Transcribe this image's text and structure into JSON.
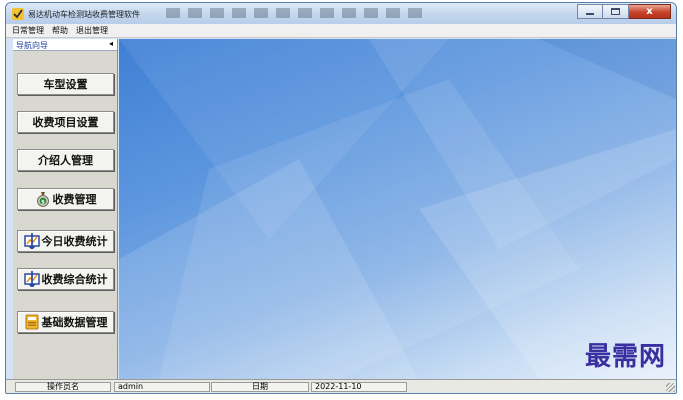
{
  "window": {
    "title": "易达机动车检测站收费管理软件",
    "title_extra": "blurred-toolbar-text",
    "icon": "app-checkmark-icon"
  },
  "window_controls": {
    "minimize_icon": "minimize-icon",
    "maximize_icon": "maximize-icon",
    "close_icon": "close-icon",
    "close_glyph": "x"
  },
  "menu": {
    "items": [
      "日常管理",
      "帮助",
      "退出管理"
    ]
  },
  "sidebar": {
    "header": "导航向导",
    "collapse_glyph": "◂",
    "items": [
      {
        "label": "车型设置",
        "icon": ""
      },
      {
        "label": "收费项目设置",
        "icon": ""
      },
      {
        "label": "介绍人管理",
        "icon": ""
      },
      {
        "label": "收费管理",
        "icon": "money-bag-icon"
      },
      {
        "label": "今日收费统计",
        "icon": "statistics-chart-icon"
      },
      {
        "label": "收费综合统计",
        "icon": "statistics-chart-icon"
      },
      {
        "label": "基础数据管理",
        "icon": "database-icon"
      }
    ]
  },
  "watermark": "最需网",
  "status": {
    "operator_label": "操作员名",
    "operator_value": "admin",
    "date_label": "日期",
    "date_value": "2022-11-10"
  },
  "colors": {
    "accent_blue": "#3f7fd4",
    "title_bar": "#c3d6ee",
    "close_red": "#c7432a",
    "watermark": "#3a2fa0"
  }
}
